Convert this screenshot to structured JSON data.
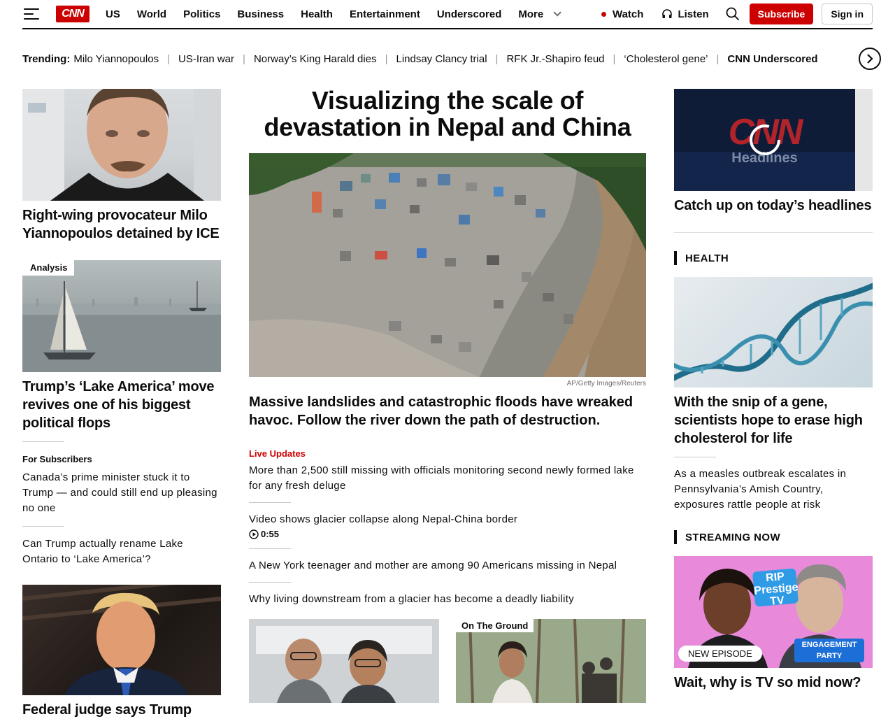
{
  "header": {
    "logo": "CNN",
    "nav": [
      "US",
      "World",
      "Politics",
      "Business",
      "Health",
      "Entertainment",
      "Underscored"
    ],
    "more_label": "More",
    "watch_label": "Watch",
    "listen_label": "Listen",
    "subscribe_label": "Subscribe",
    "signin_label": "Sign in"
  },
  "trending": {
    "label": "Trending:",
    "items": [
      "Milo Yiannopoulos",
      "US-Iran war",
      "Norway’s King Harald dies",
      "Lindsay Clancy trial",
      "RFK Jr.-Shapiro feud",
      "‘Cholesterol gene’",
      "CNN Underscored"
    ]
  },
  "left": {
    "story1": {
      "headline": "Right-wing provocateur Milo Yiannopoulos detained by ICE"
    },
    "story2": {
      "badge": "Analysis",
      "headline": "Trump’s ‘Lake America’ move revives one of his biggest political flops"
    },
    "subscribers_label": "For Subscribers",
    "link1": "Canada’s prime minister stuck it to Trump — and could still end up pleasing no one",
    "link2": "Can Trump actually rename Lake Ontario to ‘Lake America’?",
    "story3": {
      "headline": "Federal judge says Trump"
    }
  },
  "center": {
    "title": "Visualizing the scale of devastation in Nepal and China",
    "credit": "AP/Getty Images/Reuters",
    "dek": "Massive landslides and catastrophic floods have wreaked havoc. Follow the river down the path of destruction.",
    "live_label": "Live Updates",
    "link1": "More than 2,500 still missing with officials monitoring second newly formed lake for any fresh deluge",
    "link2": "Video shows glacier collapse along Nepal-China border",
    "link2_duration": "0:55",
    "link3": "A New York teenager and mother are among 90 Americans missing in Nepal",
    "link4": "Why living downstream from a glacier has become a deadly liability",
    "thumb2_badge": "On The Ground"
  },
  "right": {
    "video_headline": "Catch up on today’s headlines",
    "video_logo": "CNN",
    "video_sub": "Headlines",
    "health_label": "HEALTH",
    "health_headline": "With the snip of a gene, scientists hope to erase high cholesterol for life",
    "health_link": "As a measles outbreak escalates in Pennsylvania’s Amish Country, exposures rattle people at risk",
    "streaming_label": "STREAMING NOW",
    "stream_badge": "NEW EPISODE",
    "stream_show1": "RIP Prestige TV",
    "stream_show2": "ENGAGEMENT PARTY",
    "stream_headline": "Wait, why is TV so mid now?"
  }
}
